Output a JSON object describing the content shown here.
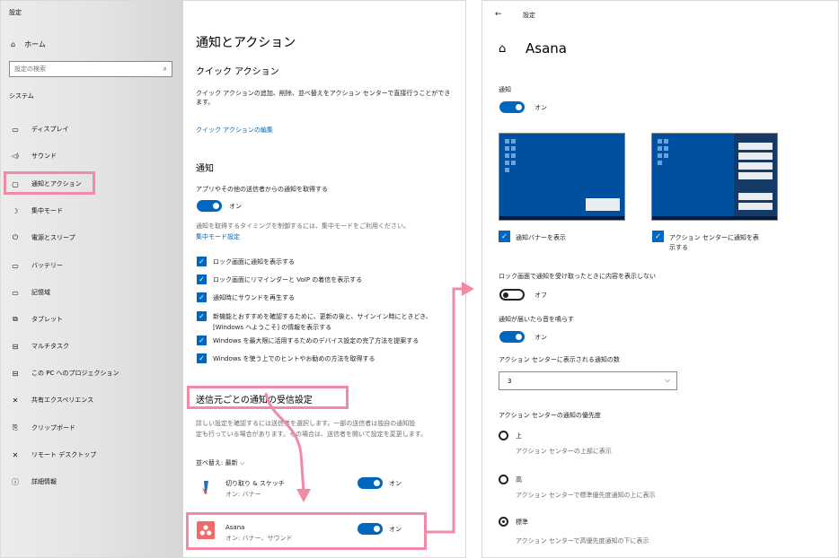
{
  "left": {
    "window_title": "設定",
    "home": "ホーム",
    "search_placeholder": "設定の検索",
    "section": "システム",
    "nav": [
      {
        "label": "ディスプレイ",
        "icon": "monitor-icon",
        "glyph": "▭"
      },
      {
        "label": "サウンド",
        "icon": "speaker-icon",
        "glyph": "🔊"
      },
      {
        "label": "通知とアクション",
        "icon": "notification-icon",
        "glyph": "▢"
      },
      {
        "label": "集中モード",
        "icon": "moon-icon",
        "glyph": "☽"
      },
      {
        "label": "電源とスリープ",
        "icon": "power-icon",
        "glyph": "⏻"
      },
      {
        "label": "バッテリー",
        "icon": "battery-icon",
        "glyph": "▭"
      },
      {
        "label": "記憶域",
        "icon": "storage-icon",
        "glyph": "▭"
      },
      {
        "label": "タブレット",
        "icon": "tablet-icon",
        "glyph": "⧉"
      },
      {
        "label": "マルチタスク",
        "icon": "multitask-icon",
        "glyph": "⊟"
      },
      {
        "label": "この PC へのプロジェクション",
        "icon": "projection-icon",
        "glyph": "⊟"
      },
      {
        "label": "共有エクスペリエンス",
        "icon": "share-icon",
        "glyph": "✕"
      },
      {
        "label": "クリップボード",
        "icon": "clipboard-icon",
        "glyph": "⎘"
      },
      {
        "label": "リモート デスクトップ",
        "icon": "remote-icon",
        "glyph": "✕"
      },
      {
        "label": "詳細情報",
        "icon": "info-icon",
        "glyph": "ⓘ"
      }
    ],
    "main": {
      "title": "通知とアクション",
      "quick_heading": "クイック アクション",
      "quick_desc": "クイック アクションの追加、削除、並べ替えをアクション センターで直接行うことができます。",
      "quick_link": "クイック アクションの編集",
      "notif_heading": "通知",
      "notif_desc": "アプリやその他の送信者からの通知を取得する",
      "on_label": "オン",
      "focus_desc": "通知を取得するタイミングを制御するには、集中モードをご利用ください。",
      "focus_link": "集中モード設定",
      "checkboxes": [
        "ロック画面に通知を表示する",
        "ロック画面にリマインダーと VoIP の着信を表示する",
        "通知時にサウンドを再生する",
        "新機能とおすすめを確認するために、更新の後と、サインイン時にときどき、",
        "[Windows へようこそ] の情報を表示する",
        "Windows を最大限に活用するためのデバイス設定の完了方法を提案する",
        "Windows を使う上でのヒントやお勧めの方法を取得する"
      ],
      "sender_heading": "送信元ごとの通知の受信設定",
      "sender_desc1": "詳しい設定を確認するには送信者を選択します。一部の送信者は独自の通知設",
      "sender_desc2": "定も行っている場合があります。その場合は、送信者を開いて設定を変更します。",
      "sort_label": "並べ替え: 最新",
      "apps": [
        {
          "name": "切り取り & スケッチ",
          "status": "オン: バナー",
          "toggle": "オン"
        },
        {
          "name": "Asana",
          "status": "オン: バナー、サウンド",
          "toggle": "オン"
        }
      ]
    }
  },
  "right": {
    "window_title": "設定",
    "app_title": "Asana",
    "notif_label": "通知",
    "notif_toggle": "オン",
    "preview1_label": "通知バナーを表示",
    "preview2_label_line1": "アクション センターに通知を表",
    "preview2_label_line2": "示する",
    "lock_label": "ロック画面で通知を受け取ったときに内容を表示しない",
    "lock_toggle": "オフ",
    "sound_label": "通知が届いたら音を鳴らす",
    "sound_toggle": "オン",
    "count_label": "アクション センターに表示される通知の数",
    "count_value": "3",
    "priority_label": "アクション センターの通知の優先度",
    "priorities": [
      {
        "label": "上",
        "desc": "アクション センターの上部に表示",
        "selected": false
      },
      {
        "label": "高",
        "desc": "アクション センターで標準優先度通知の上に表示",
        "selected": false
      },
      {
        "label": "標準",
        "desc": "アクション センターで高優先度通知の下に表示",
        "selected": true
      }
    ]
  },
  "colors": {
    "accent": "#0067c0",
    "highlight": "#f08aa5",
    "preview_bg": "#0050a0"
  }
}
